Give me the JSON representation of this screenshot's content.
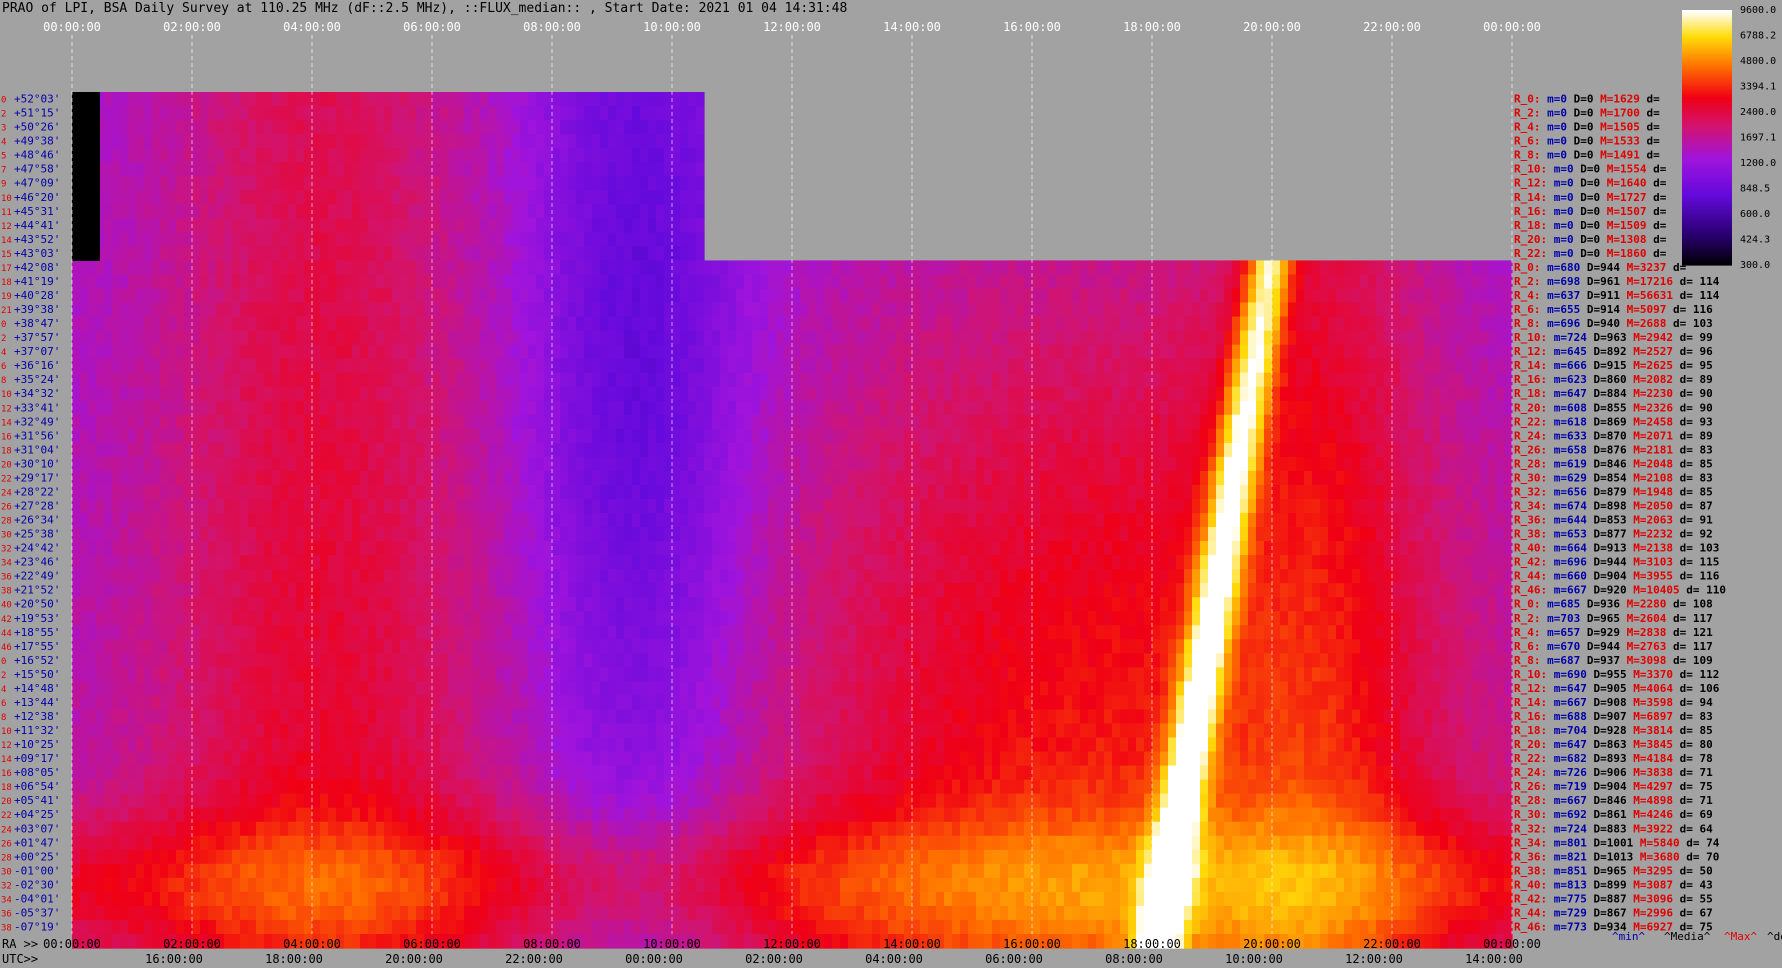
{
  "title": "PRAO of LPI, BSA Daily Survey at 110.25 MHz (dF::2.5 MHz), ::FLUX_median:: , Start Date: 2021 01 04 14:31:48",
  "footer": {
    "ra_prefix": "RA >>",
    "utc_prefix": "UTC>>",
    "legend_min": "^min^",
    "legend_media": "^Media^",
    "legend_max": "^Max^",
    "legend_devia": "^devia"
  },
  "colors": {
    "background": "#a2a2a2",
    "label_red": "#e00000",
    "label_blue": "#0000aa",
    "label_black": "#000000"
  },
  "chart_data": {
    "type": "heatmap",
    "colormap": "dark purple - violet - red - orange - yellow - white",
    "x_top_ticks": [
      "00:00:00",
      "02:00:00",
      "04:00:00",
      "06:00:00",
      "08:00:00",
      "10:00:00",
      "12:00:00",
      "14:00:00",
      "16:00:00",
      "18:00:00",
      "20:00:00",
      "22:00:00",
      "00:00:00"
    ],
    "x_ra_ticks": [
      "00:00:00",
      "02:00:00",
      "04:00:00",
      "06:00:00",
      "08:00:00",
      "10:00:00",
      "12:00:00",
      "14:00:00",
      "16:00:00",
      "18:00:00",
      "20:00:00",
      "22:00:00",
      "00:00:00"
    ],
    "x_utc_ticks": [
      "16:00:00",
      "18:00:00",
      "20:00:00",
      "22:00:00",
      "00:00:00",
      "02:00:00",
      "04:00:00",
      "06:00:00",
      "08:00:00",
      "10:00:00",
      "12:00:00",
      "14:00:00"
    ],
    "colorbar_ticks": [
      "9600.0",
      "6788.2",
      "4800.0",
      "3394.1",
      "2400.0",
      "1697.1",
      "1200.0",
      "848.5",
      "600.0",
      "424.3",
      "300.0"
    ],
    "dec_labels": [
      "+52°03'",
      "+51°15'",
      "+50°26'",
      "+49°38'",
      "+48°46'",
      "+47°58'",
      "+47°09'",
      "+46°20'",
      "+45°31'",
      "+44°41'",
      "+43°52'",
      "+43°03'",
      "+42°08'",
      "+41°19'",
      "+40°28'",
      "+39°38'",
      "+38°47'",
      "+37°57'",
      "+37°07'",
      "+36°16'",
      "+35°24'",
      "+34°32'",
      "+33°41'",
      "+32°49'",
      "+31°56'",
      "+31°04'",
      "+30°10'",
      "+29°17'",
      "+28°22'",
      "+27°28'",
      "+26°34'",
      "+25°38'",
      "+24°42'",
      "+23°46'",
      "+22°49'",
      "+21°52'",
      "+20°50'",
      "+19°53'",
      "+18°55'",
      "+17°55'",
      "+16°52'",
      "+15°50'",
      "+14°48'",
      "+13°44'",
      "+12°38'",
      "+11°32'",
      "+10°25'",
      "+09°17'",
      "+08°05'",
      "+06°54'",
      "+05°41'",
      "+04°25'",
      "+03°07'",
      "+01°47'",
      "+00°25'",
      "-01°00'",
      "-02°30'",
      "-04°01'",
      "-05°37'",
      "-07°19'"
    ],
    "row_numbers": [
      "0",
      "2",
      "3",
      "4",
      "5",
      "7",
      "9",
      "10",
      "11",
      "12",
      "14",
      "15",
      "17",
      "18",
      "19",
      "21",
      "0",
      "2",
      "4",
      "6",
      "8",
      "10",
      "12",
      "14",
      "16",
      "18",
      "20",
      "22",
      "24",
      "26",
      "28",
      "30",
      "32",
      "34",
      "36",
      "38",
      "40",
      "42",
      "44",
      "46",
      "0",
      "2",
      "4",
      "6",
      "8",
      "10",
      "12",
      "14",
      "16",
      "18",
      "20",
      "22",
      "24",
      "26",
      "28",
      "30",
      "32",
      "34",
      "36",
      "38"
    ],
    "stats": [
      {
        "r": "R_0:",
        "min": "m=0",
        "med": "D=0",
        "max": "M=1629",
        "dev": "d="
      },
      {
        "r": "R_2:",
        "min": "m=0",
        "med": "D=0",
        "max": "M=1700",
        "dev": "d="
      },
      {
        "r": "R_4:",
        "min": "m=0",
        "med": "D=0",
        "max": "M=1505",
        "dev": "d="
      },
      {
        "r": "R_6:",
        "min": "m=0",
        "med": "D=0",
        "max": "M=1533",
        "dev": "d="
      },
      {
        "r": "R_8:",
        "min": "m=0",
        "med": "D=0",
        "max": "M=1491",
        "dev": "d="
      },
      {
        "r": "R_10:",
        "min": "m=0",
        "med": "D=0",
        "max": "M=1554",
        "dev": "d="
      },
      {
        "r": "R_12:",
        "min": "m=0",
        "med": "D=0",
        "max": "M=1640",
        "dev": "d="
      },
      {
        "r": "R_14:",
        "min": "m=0",
        "med": "D=0",
        "max": "M=1727",
        "dev": "d="
      },
      {
        "r": "R_16:",
        "min": "m=0",
        "med": "D=0",
        "max": "M=1507",
        "dev": "d="
      },
      {
        "r": "R_18:",
        "min": "m=0",
        "med": "D=0",
        "max": "M=1509",
        "dev": "d="
      },
      {
        "r": "R_20:",
        "min": "m=0",
        "med": "D=0",
        "max": "M=1308",
        "dev": "d="
      },
      {
        "r": "R_22:",
        "min": "m=0",
        "med": "D=0",
        "max": "M=1860",
        "dev": "d="
      },
      {
        "r": "R_0:",
        "min": "m=680",
        "med": "D=944",
        "max": "M=3237",
        "dev": "d="
      },
      {
        "r": "R_2:",
        "min": "m=698",
        "med": "D=961",
        "max": "M=17216",
        "dev": "d= 114"
      },
      {
        "r": "R_4:",
        "min": "m=637",
        "med": "D=911",
        "max": "M=56631",
        "dev": "d= 114"
      },
      {
        "r": "R_6:",
        "min": "m=655",
        "med": "D=914",
        "max": "M=5097",
        "dev": "d= 116"
      },
      {
        "r": "R_8:",
        "min": "m=696",
        "med": "D=940",
        "max": "M=2688",
        "dev": "d= 103"
      },
      {
        "r": "R_10:",
        "min": "m=724",
        "med": "D=963",
        "max": "M=2942",
        "dev": "d= 99"
      },
      {
        "r": "R_12:",
        "min": "m=645",
        "med": "D=892",
        "max": "M=2527",
        "dev": "d= 96"
      },
      {
        "r": "R_14:",
        "min": "m=666",
        "med": "D=915",
        "max": "M=2625",
        "dev": "d= 95"
      },
      {
        "r": "R_16:",
        "min": "m=623",
        "med": "D=860",
        "max": "M=2082",
        "dev": "d= 89"
      },
      {
        "r": "R_18:",
        "min": "m=647",
        "med": "D=884",
        "max": "M=2230",
        "dev": "d= 90"
      },
      {
        "r": "R_20:",
        "min": "m=608",
        "med": "D=855",
        "max": "M=2326",
        "dev": "d= 90"
      },
      {
        "r": "R_22:",
        "min": "m=618",
        "med": "D=869",
        "max": "M=2458",
        "dev": "d= 93"
      },
      {
        "r": "R_24:",
        "min": "m=633",
        "med": "D=870",
        "max": "M=2071",
        "dev": "d= 89"
      },
      {
        "r": "R_26:",
        "min": "m=658",
        "med": "D=876",
        "max": "M=2181",
        "dev": "d= 83"
      },
      {
        "r": "R_28:",
        "min": "m=619",
        "med": "D=846",
        "max": "M=2048",
        "dev": "d= 85"
      },
      {
        "r": "R_30:",
        "min": "m=629",
        "med": "D=854",
        "max": "M=2108",
        "dev": "d= 83"
      },
      {
        "r": "R_32:",
        "min": "m=656",
        "med": "D=879",
        "max": "M=1948",
        "dev": "d= 85"
      },
      {
        "r": "R_34:",
        "min": "m=674",
        "med": "D=898",
        "max": "M=2050",
        "dev": "d= 87"
      },
      {
        "r": "R_36:",
        "min": "m=644",
        "med": "D=853",
        "max": "M=2063",
        "dev": "d= 91"
      },
      {
        "r": "R_38:",
        "min": "m=653",
        "med": "D=877",
        "max": "M=2232",
        "dev": "d= 92"
      },
      {
        "r": "R_40:",
        "min": "m=664",
        "med": "D=913",
        "max": "M=2138",
        "dev": "d= 103"
      },
      {
        "r": "R_42:",
        "min": "m=696",
        "med": "D=944",
        "max": "M=3103",
        "dev": "d= 115"
      },
      {
        "r": "R_44:",
        "min": "m=660",
        "med": "D=904",
        "max": "M=3955",
        "dev": "d= 116"
      },
      {
        "r": "R_46:",
        "min": "m=667",
        "med": "D=920",
        "max": "M=10405",
        "dev": "d= 110"
      },
      {
        "r": "R_0:",
        "min": "m=685",
        "med": "D=936",
        "max": "M=2280",
        "dev": "d= 108"
      },
      {
        "r": "R_2:",
        "min": "m=703",
        "med": "D=965",
        "max": "M=2604",
        "dev": "d= 117"
      },
      {
        "r": "R_4:",
        "min": "m=657",
        "med": "D=929",
        "max": "M=2838",
        "dev": "d= 121"
      },
      {
        "r": "R_6:",
        "min": "m=670",
        "med": "D=944",
        "max": "M=2763",
        "dev": "d= 117"
      },
      {
        "r": "R_8:",
        "min": "m=687",
        "med": "D=937",
        "max": "M=3098",
        "dev": "d= 109"
      },
      {
        "r": "R_10:",
        "min": "m=690",
        "med": "D=955",
        "max": "M=3370",
        "dev": "d= 112"
      },
      {
        "r": "R_12:",
        "min": "m=647",
        "med": "D=905",
        "max": "M=4064",
        "dev": "d= 106"
      },
      {
        "r": "R_14:",
        "min": "m=667",
        "med": "D=908",
        "max": "M=3598",
        "dev": "d= 94"
      },
      {
        "r": "R_16:",
        "min": "m=688",
        "med": "D=907",
        "max": "M=6897",
        "dev": "d= 83"
      },
      {
        "r": "R_18:",
        "min": "m=704",
        "med": "D=928",
        "max": "M=3814",
        "dev": "d= 85"
      },
      {
        "r": "R_20:",
        "min": "m=647",
        "med": "D=863",
        "max": "M=3845",
        "dev": "d= 80"
      },
      {
        "r": "R_22:",
        "min": "m=682",
        "med": "D=893",
        "max": "M=4184",
        "dev": "d= 78"
      },
      {
        "r": "R_24:",
        "min": "m=726",
        "med": "D=906",
        "max": "M=3838",
        "dev": "d= 71"
      },
      {
        "r": "R_26:",
        "min": "m=719",
        "med": "D=904",
        "max": "M=4297",
        "dev": "d= 75"
      },
      {
        "r": "R_28:",
        "min": "m=667",
        "med": "D=846",
        "max": "M=4898",
        "dev": "d= 71"
      },
      {
        "r": "R_30:",
        "min": "m=692",
        "med": "D=861",
        "max": "M=4246",
        "dev": "d= 69"
      },
      {
        "r": "R_32:",
        "min": "m=724",
        "med": "D=883",
        "max": "M=3922",
        "dev": "d= 64"
      },
      {
        "r": "R_34:",
        "min": "m=801",
        "med": "D=1001",
        "max": "M=5840",
        "dev": "d= 74"
      },
      {
        "r": "R_36:",
        "min": "m=821",
        "med": "D=1013",
        "max": "M=3680",
        "dev": "d= 70"
      },
      {
        "r": "R_38:",
        "min": "m=851",
        "med": "D=965",
        "max": "M=3295",
        "dev": "d= 50"
      },
      {
        "r": "R_40:",
        "min": "m=813",
        "med": "D=899",
        "max": "M=3087",
        "dev": "d= 43"
      },
      {
        "r": "R_42:",
        "min": "m=775",
        "med": "D=887",
        "max": "M=3096",
        "dev": "d= 55"
      },
      {
        "r": "R_44:",
        "min": "m=729",
        "med": "D=867",
        "max": "M=2996",
        "dev": "d= 67"
      },
      {
        "r": "R_46:",
        "min": "m=773",
        "med": "D=934",
        "max": "M=6927",
        "dev": "d= 75"
      }
    ]
  }
}
